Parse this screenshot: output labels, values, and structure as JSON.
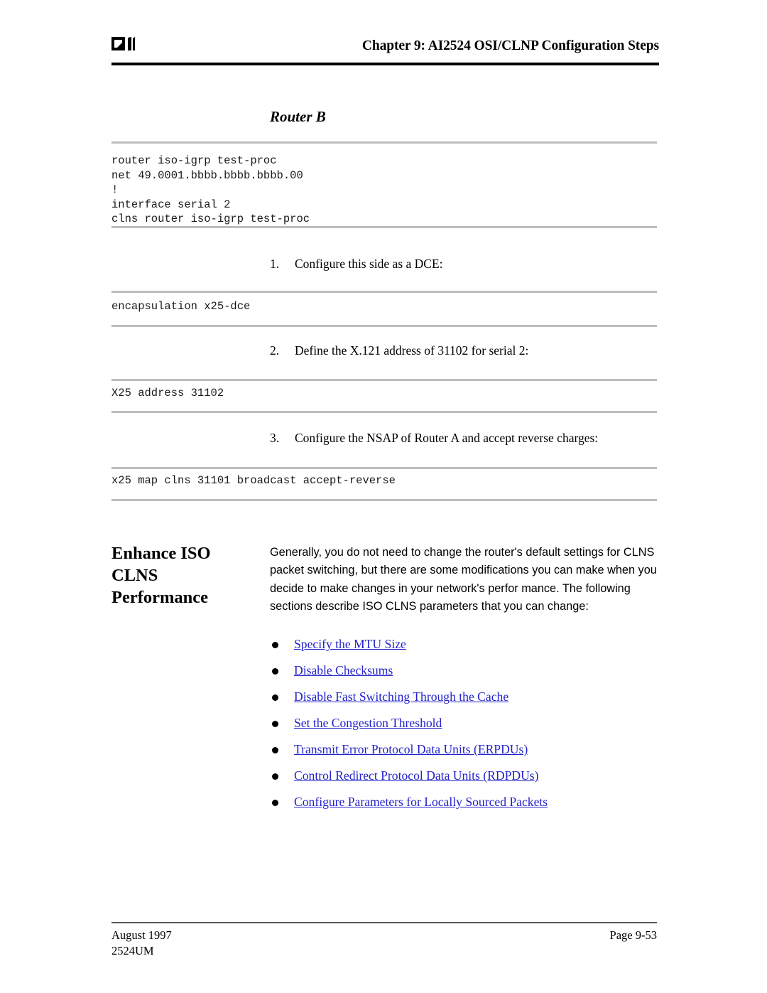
{
  "header": {
    "logo_name": "ai-logo",
    "chapter_title": "Chapter 9: AI2524 OSI/CLNP Configuration Steps"
  },
  "router_section": {
    "heading": "Router B",
    "config_code": "router iso-igrp test-proc\nnet 49.0001.bbbb.bbbb.bbbb.00\n!\ninterface serial 2\nclns router iso-igrp test-proc"
  },
  "steps": [
    {
      "number": "1.",
      "text": "Configure this side as a DCE:",
      "code": "encapsulation x25-dce"
    },
    {
      "number": "2.",
      "text": "Define the X.121 address of 31102 for serial 2:",
      "code": "X25 address 31102"
    },
    {
      "number": "3.",
      "text": "Configure the NSAP of Router A and accept reverse charges:",
      "code": "x25 map clns 31101 broadcast accept-reverse"
    }
  ],
  "enhance_section": {
    "side_heading": "Enhance ISO CLNS Performance",
    "paragraph": "Generally, you do not need to change the router's default settings for CLNS packet switching, but there are some modifications you can make when you decide to make changes in your network's perfor mance. The following sections describe ISO CLNS parameters that you can change:",
    "links": [
      "Specify the MTU Size",
      "Disable Checksums",
      "Disable Fast Switching Through the Cache",
      "Set the Congestion Threshold",
      "Transmit Error Protocol Data Units (ERPDUs)",
      "Control Redirect Protocol Data Units (RDPDUs)",
      "Configure Parameters for Locally Sourced Packets"
    ]
  },
  "footer": {
    "date": "August 1997",
    "doc_code": "2524UM",
    "page_number": "Page 9-53"
  },
  "colors": {
    "link": "#2222cc",
    "rule": "#bdbdbd",
    "header_rule": "#000000"
  }
}
